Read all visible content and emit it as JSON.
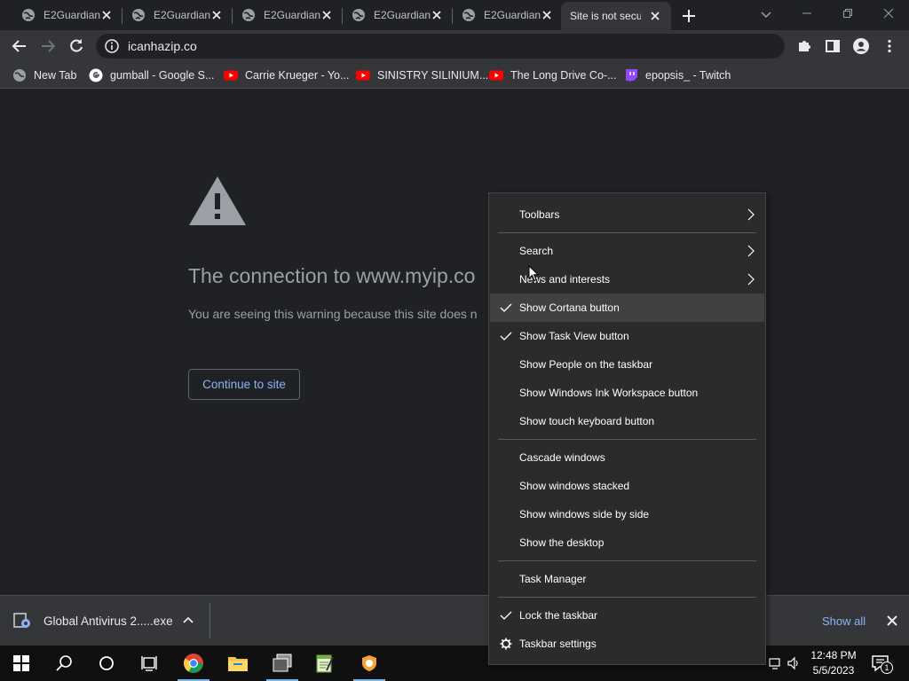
{
  "browser": {
    "tabs": [
      {
        "title": "E2Guardian",
        "favicon": "globe-icon"
      },
      {
        "title": "E2Guardian",
        "favicon": "globe-icon"
      },
      {
        "title": "E2Guardian",
        "favicon": "globe-icon"
      },
      {
        "title": "E2Guardian",
        "favicon": "globe-icon"
      },
      {
        "title": "E2Guardian",
        "favicon": "globe-icon"
      },
      {
        "title": "Site is not secure",
        "favicon": "none",
        "active": true
      }
    ],
    "url": "icanhazip.co",
    "bookmarks": [
      {
        "label": "New Tab",
        "icon": "globe-icon"
      },
      {
        "label": "gumball - Google S...",
        "icon": "google-icon"
      },
      {
        "label": "Carrie Krueger - Yo...",
        "icon": "youtube-icon"
      },
      {
        "label": "SINISTRY SILINIUM...",
        "icon": "youtube-icon"
      },
      {
        "label": "The Long Drive Co-...",
        "icon": "youtube-icon"
      },
      {
        "label": "epopsis_ - Twitch",
        "icon": "twitch-icon"
      }
    ]
  },
  "page": {
    "headline": "The connection to www.myip.co",
    "subtext": "You are seeing this warning because this site does n",
    "continue_label": "Continue to site"
  },
  "downloads": {
    "item": "Global Antivirus  2.....exe",
    "show_all": "Show all"
  },
  "context_menu": {
    "items": [
      {
        "label": "Toolbars",
        "submenu": true
      },
      {
        "label": "Search",
        "submenu": true
      },
      {
        "label": "News and interests",
        "submenu": true
      },
      {
        "label": "Show Cortana button",
        "checked": true,
        "highlighted": true
      },
      {
        "label": "Show Task View button",
        "checked": true
      },
      {
        "label": "Show People on the taskbar"
      },
      {
        "label": "Show Windows Ink Workspace button"
      },
      {
        "label": "Show touch keyboard button"
      },
      {
        "label": "Cascade windows"
      },
      {
        "label": "Show windows stacked"
      },
      {
        "label": "Show windows side by side"
      },
      {
        "label": "Show the desktop"
      },
      {
        "label": "Task Manager"
      },
      {
        "label": "Lock the taskbar",
        "checked": true
      },
      {
        "label": "Taskbar settings",
        "icon": "gear-icon"
      }
    ]
  },
  "taskbar": {
    "time": "12:48 PM",
    "date": "5/5/2023",
    "notification_count": "1"
  },
  "colors": {
    "page_bg": "#202124",
    "toolbar_bg": "#35363a",
    "link": "#8ab4f8",
    "menu_bg": "#2b2b2b",
    "taskbar_bg": "#101010"
  }
}
